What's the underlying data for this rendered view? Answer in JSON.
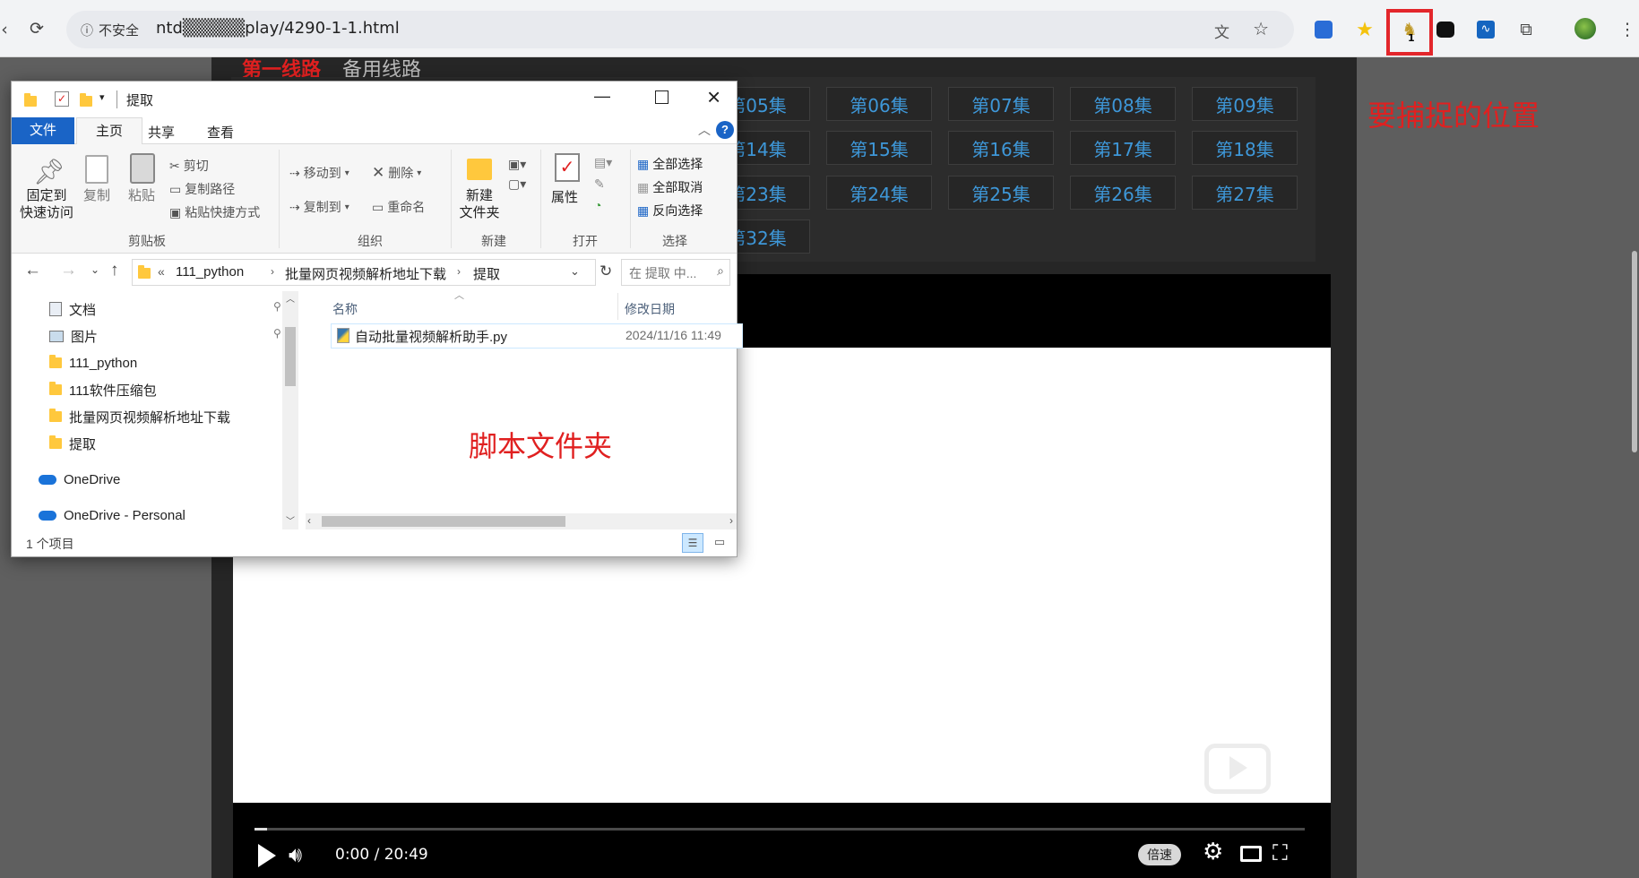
{
  "browser": {
    "security_label": "不安全",
    "url": "ntd▒▒▒▒▒play/4290-1-1.html",
    "extension_badge": "1"
  },
  "page": {
    "line1_label": "第一线路",
    "line2_label": "备用线路",
    "episodes": [
      "第05集",
      "第06集",
      "第07集",
      "第08集",
      "第09集",
      "第14集",
      "第15集",
      "第16集",
      "第17集",
      "第18集",
      "第23集",
      "第24集",
      "第25集",
      "第26集",
      "第27集",
      "第32集"
    ],
    "annotation": "要捕捉的位置"
  },
  "player": {
    "time": "0:00 / 20:49",
    "speed_label": "倍速"
  },
  "explorer": {
    "title": "提取",
    "tabs": {
      "file": "文件",
      "home": "主页",
      "share": "共享",
      "view": "查看"
    },
    "ribbon": {
      "pin_quick": "固定到\n快速访问",
      "copy": "复制",
      "paste": "粘贴",
      "cut": "剪切",
      "copy_path": "复制路径",
      "paste_shortcut": "粘贴快捷方式",
      "move_to": "移动到",
      "copy_to": "复制到",
      "delete": "删除",
      "rename": "重命名",
      "new_folder": "新建\n文件夹",
      "properties": "属性",
      "select_all": "全部选择",
      "select_none": "全部取消",
      "invert_select": "反向选择",
      "group_clipboard": "剪贴板",
      "group_organize": "组织",
      "group_new": "新建",
      "group_open": "打开",
      "group_select": "选择"
    },
    "address": {
      "root": "«",
      "crumbs": [
        "111_python",
        "批量网页视频解析地址下载",
        "提取"
      ]
    },
    "search_placeholder": "在 提取 中...",
    "nav": [
      "文档",
      "图片",
      "111_python",
      "111软件压缩包",
      "批量网页视频解析地址下载",
      "提取",
      "OneDrive",
      "OneDrive - Personal"
    ],
    "columns": {
      "name": "名称",
      "date": "修改日期"
    },
    "files": [
      {
        "name": "自动批量视频解析助手.py",
        "date": "2024/11/16 11:49"
      }
    ],
    "annotation": "脚本文件夹",
    "status": "1 个项目"
  },
  "colors": {
    "annotation_red": "#e02020",
    "episode_blue": "#3e97d8",
    "highlight_box": "#e3262b"
  }
}
